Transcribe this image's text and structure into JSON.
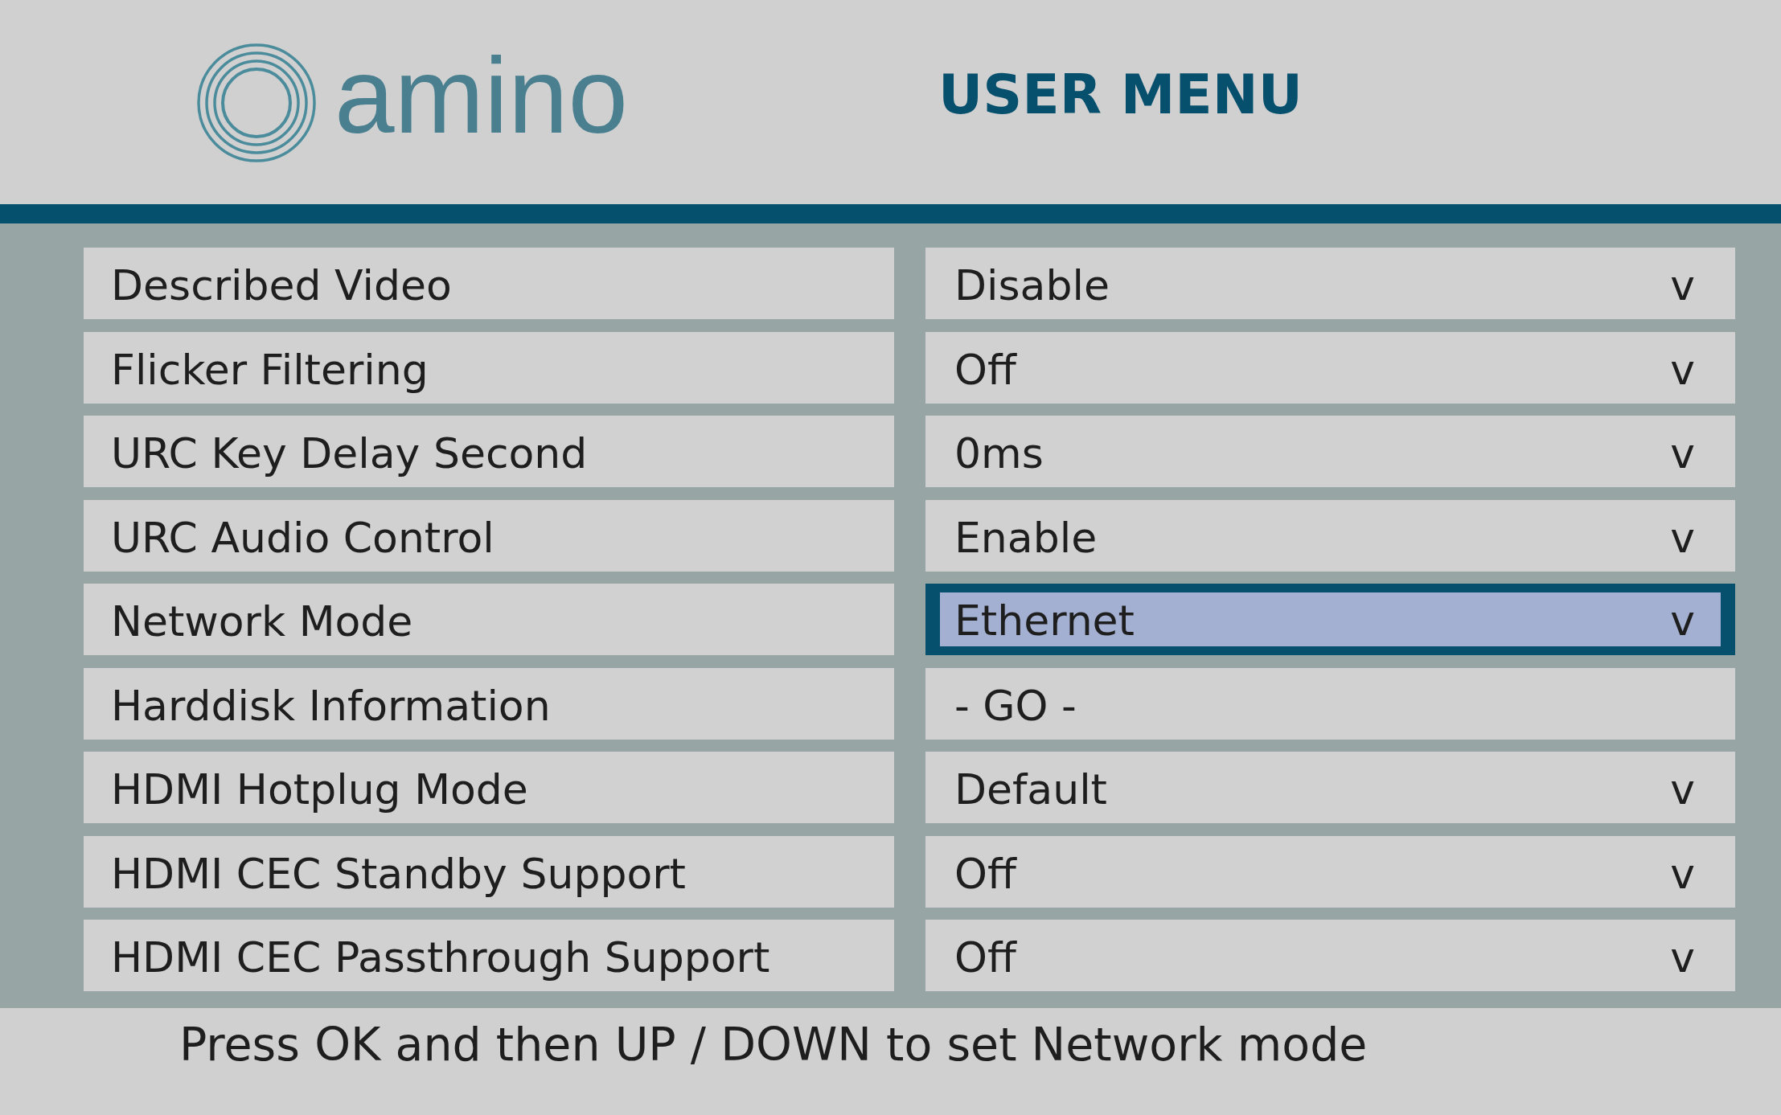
{
  "header": {
    "logo_text": "amino",
    "title": "USER MENU"
  },
  "settings": [
    {
      "label": "Described Video",
      "value": "Disable",
      "indicator": "v",
      "selected": false
    },
    {
      "label": "Flicker Filtering",
      "value": "Off",
      "indicator": "v",
      "selected": false
    },
    {
      "label": "URC Key Delay Second",
      "value": "0ms",
      "indicator": "v",
      "selected": false
    },
    {
      "label": "URC Audio Control",
      "value": "Enable",
      "indicator": "v",
      "selected": false
    },
    {
      "label": "Network Mode",
      "value": "Ethernet",
      "indicator": "v",
      "selected": true
    },
    {
      "label": "Harddisk Information",
      "value": "- GO -",
      "selected": false
    },
    {
      "label": "HDMI Hotplug Mode",
      "value": "Default",
      "indicator": "v",
      "selected": false
    },
    {
      "label": "HDMI CEC Standby Support",
      "value": "Off",
      "indicator": "v",
      "selected": false
    },
    {
      "label": "HDMI CEC Passthrough Support",
      "value": "Off",
      "indicator": "v",
      "selected": false
    }
  ],
  "hint": "Press OK and then UP / DOWN to set Network mode"
}
